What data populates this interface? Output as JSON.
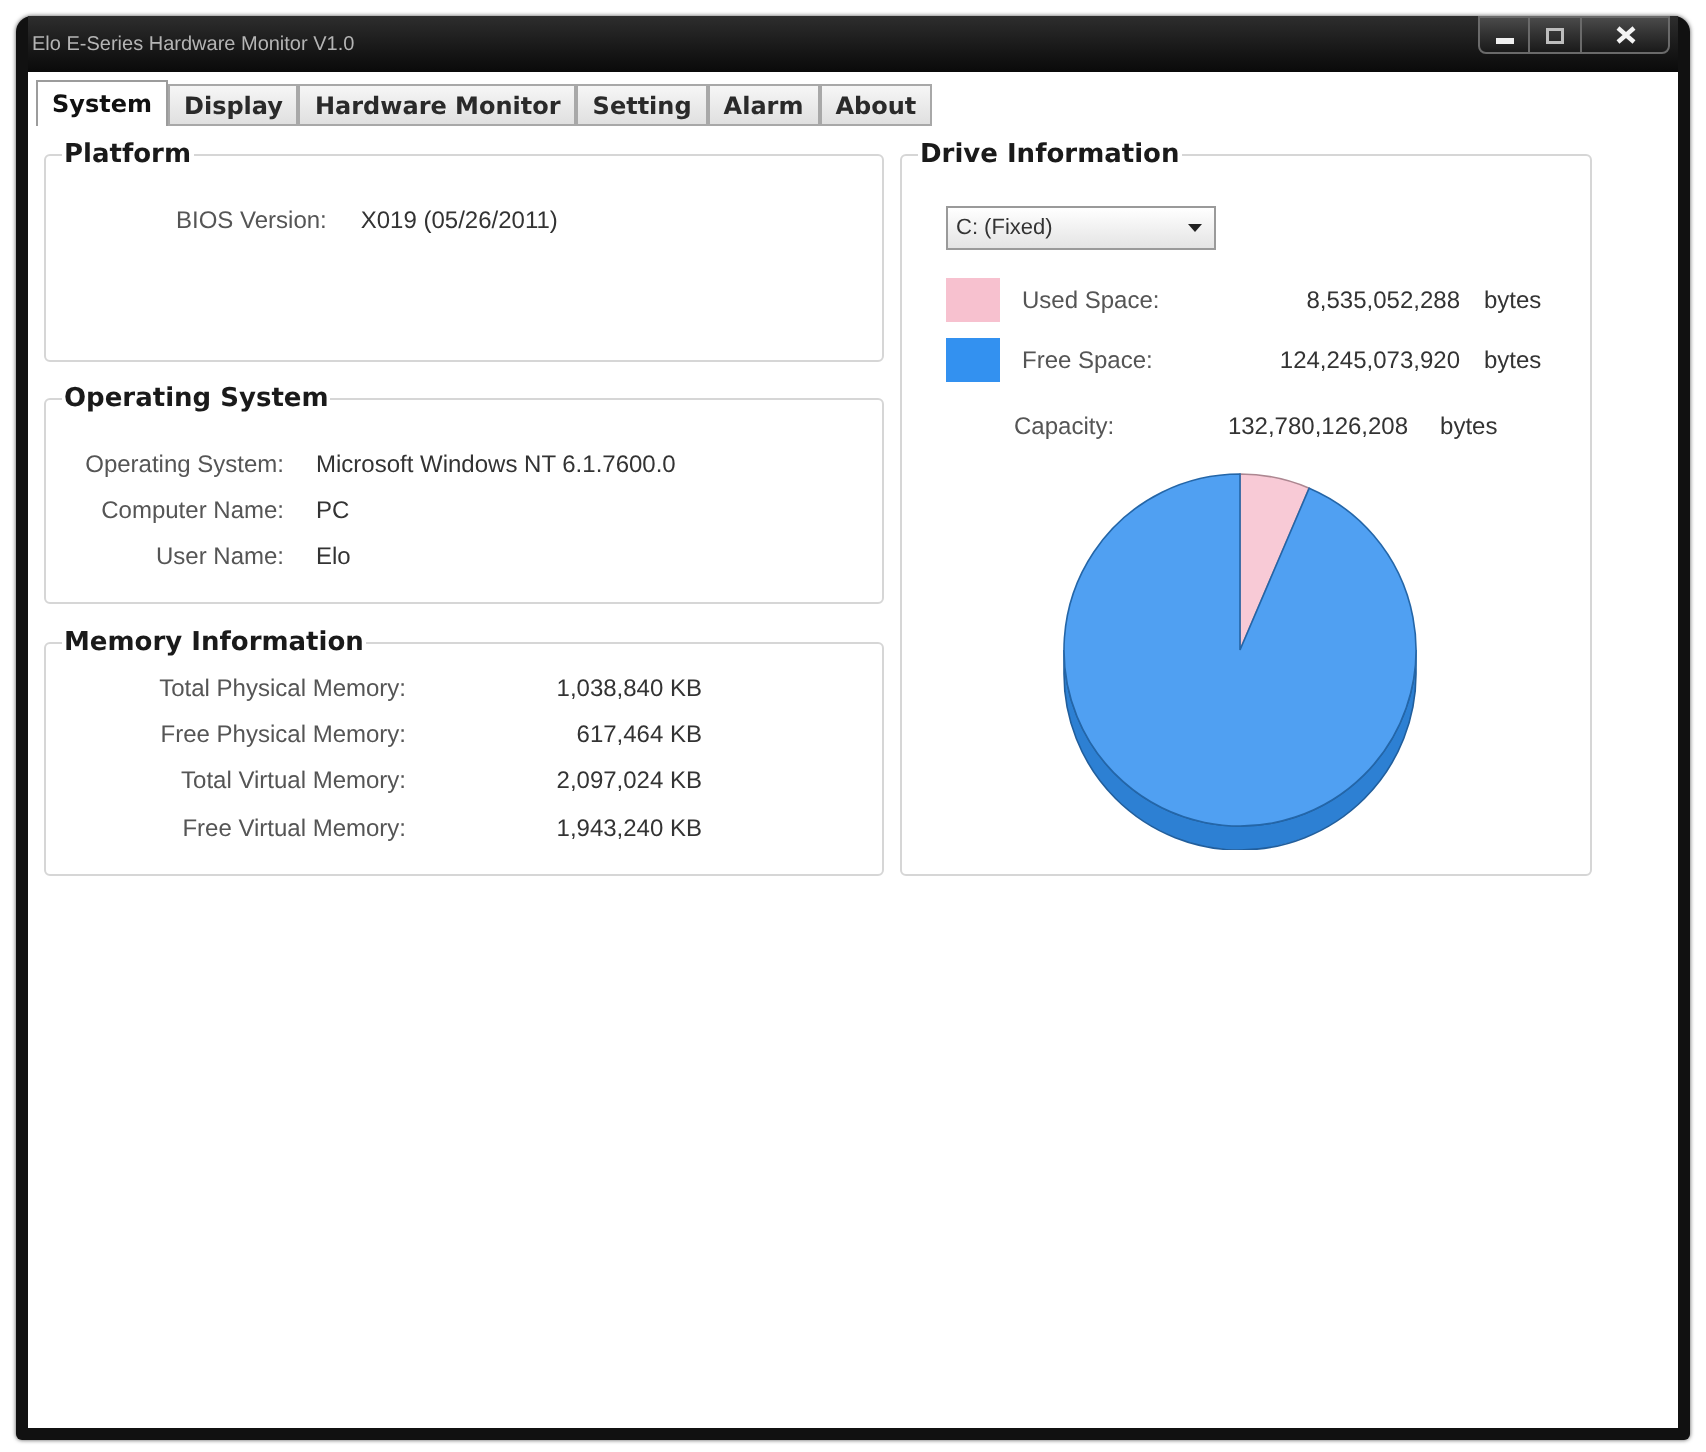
{
  "window": {
    "title": "Elo E-Series Hardware Monitor V1.0"
  },
  "tabs": [
    {
      "label": "System",
      "selected": true
    },
    {
      "label": "Display",
      "selected": false
    },
    {
      "label": "Hardware Monitor",
      "selected": false
    },
    {
      "label": "Setting",
      "selected": false
    },
    {
      "label": "Alarm",
      "selected": false
    },
    {
      "label": "About",
      "selected": false
    }
  ],
  "platform": {
    "title": "Platform",
    "fields": [
      {
        "label": "BIOS Version:",
        "value": "X019 (05/26/2011)"
      }
    ]
  },
  "operating_system": {
    "title": "Operating System",
    "fields": [
      {
        "label": "Operating System:",
        "value": "Microsoft Windows NT 6.1.7600.0"
      },
      {
        "label": "Computer Name:",
        "value": "PC"
      },
      {
        "label": "User Name:",
        "value": "Elo"
      }
    ]
  },
  "memory": {
    "title": "Memory Information",
    "fields": [
      {
        "label": "Total Physical Memory:",
        "value": "1,038,840 KB"
      },
      {
        "label": "Free Physical Memory:",
        "value": "617,464 KB"
      },
      {
        "label": "Total Virtual Memory:",
        "value": "2,097,024 KB"
      },
      {
        "label": "Free Virtual Memory:",
        "value": "1,943,240 KB"
      }
    ]
  },
  "drive": {
    "title": "Drive Information",
    "drive_select": {
      "value": "C: (Fixed)"
    },
    "legend": [
      {
        "label": "Used Space:",
        "value": "8,535,052,288",
        "unit": "bytes",
        "color": "#f7c1cf"
      },
      {
        "label": "Free Space:",
        "value": "124,245,073,920",
        "unit": "bytes",
        "color": "#3391f0"
      }
    ],
    "capacity": {
      "label": "Capacity:",
      "value": "132,780,126,208",
      "unit": "bytes"
    },
    "chart_data": {
      "type": "pie",
      "values": [
        6.43,
        93.57
      ]
    }
  }
}
